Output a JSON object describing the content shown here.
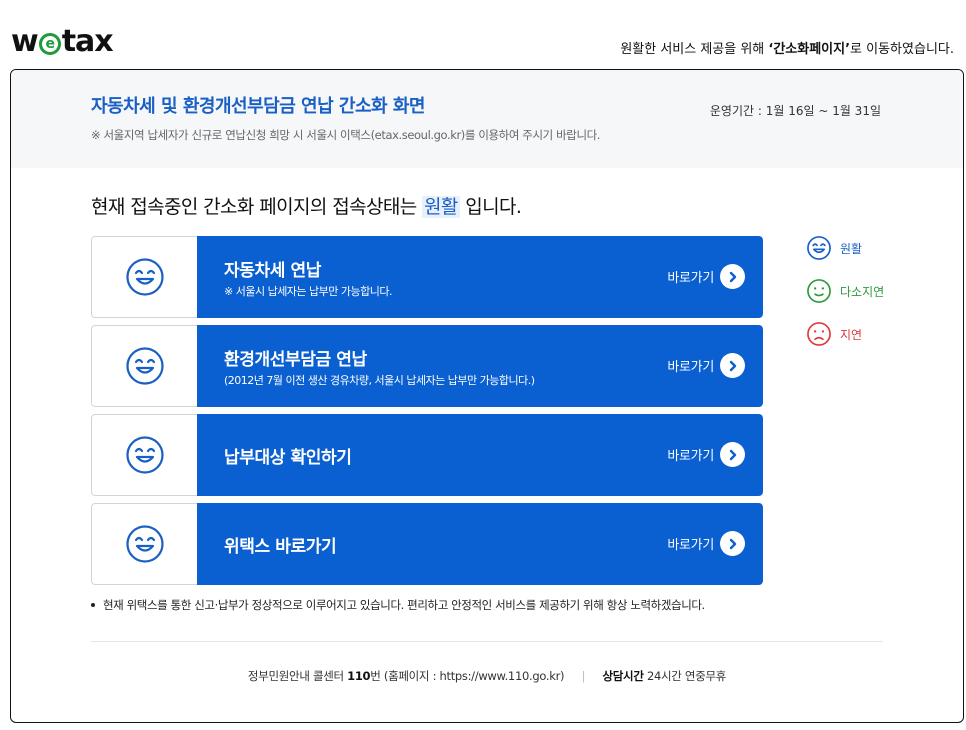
{
  "header": {
    "logo_text": "wetax",
    "redirect_note_prefix": "원활한 서비스 제공을 위해 ",
    "redirect_note_highlight": "‘간소화페이지’",
    "redirect_note_suffix": "로 이동하였습니다."
  },
  "panel": {
    "title": "자동차세 및 환경개선부담금 연납 간소화 화면",
    "notice": "※ 서울지역 납세자가 신규로 연납신청 희망 시 서울시 이택스(etax.seoul.go.kr)를 이용하여 주시기 바랍니다.",
    "period": "운영기간 : 1월 16일 ~ 1월 31일"
  },
  "status": {
    "prefix": "현재 접속중인 간소화 페이지의 접속상태는 ",
    "value": "원활",
    "suffix": " 입니다."
  },
  "services": [
    {
      "title": "자동차세 연납",
      "subtitle": "※ 서울시 납세자는 납부만 가능합니다.",
      "go_label": "바로가기"
    },
    {
      "title": "환경개선부담금 연납",
      "subtitle": "(2012년 7월 이전 생산 경유차량, 서울시 납세자는 납부만 가능합니다.)",
      "go_label": "바로가기"
    },
    {
      "title": "납부대상 확인하기",
      "subtitle": "",
      "go_label": "바로가기"
    },
    {
      "title": "위택스 바로가기",
      "subtitle": "",
      "go_label": "바로가기"
    }
  ],
  "legend": [
    {
      "label": "원활",
      "color": "#1a5fc4",
      "icon": "smile-icon"
    },
    {
      "label": "다소지연",
      "color": "#2e9a3c",
      "icon": "neutral-face-icon"
    },
    {
      "label": "지연",
      "color": "#e0393a",
      "icon": "sad-face-icon"
    }
  ],
  "bullet_note": "현재 위택스를 통한 신고·납부가 정상적으로 이루어지고 있습니다. 편리하고 안정적인 서비스를 제공하기 위해 항상 노력하겠습니다.",
  "footer": {
    "callcenter_prefix": "정부민원안내 콜센터 ",
    "callcenter_number": "110",
    "callcenter_suffix": "번 (홈페이지 : https://www.110.go.kr)",
    "separator": "|",
    "hours_label": "상담시간",
    "hours_value": " 24시간 연중무휴"
  },
  "colors": {
    "accent": "#0a5fd1",
    "title_blue": "#1a5fc4",
    "smooth": "#1a5fc4",
    "moderate": "#2e9a3c",
    "delayed": "#e0393a"
  }
}
